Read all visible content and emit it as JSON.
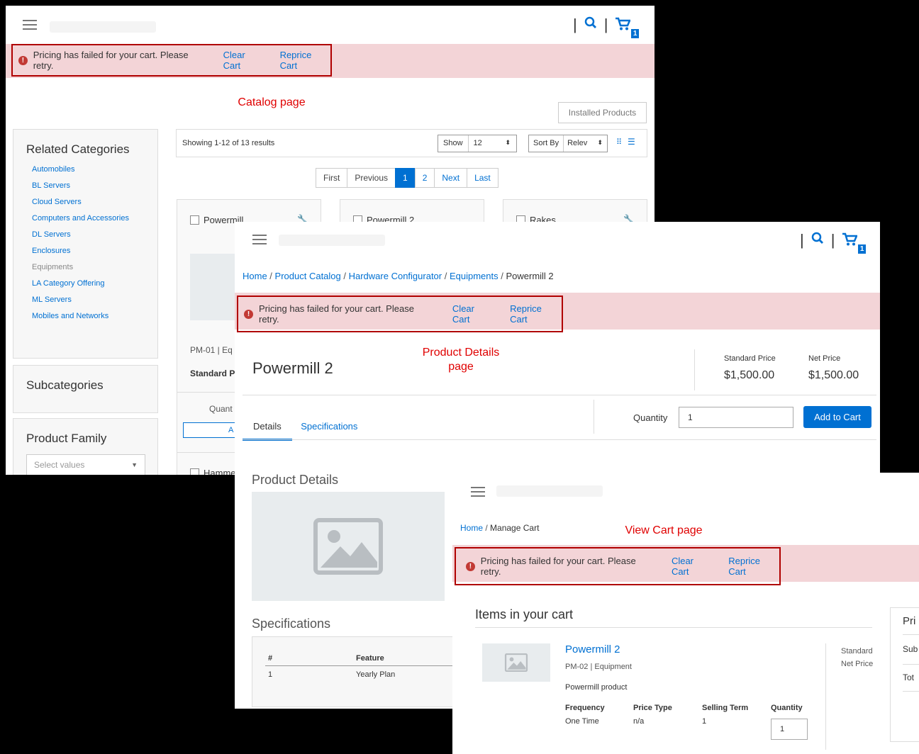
{
  "alert": {
    "message": "Pricing has failed for your cart. Please retry.",
    "clear_label": "Clear Cart",
    "reprice_label": "Reprice Cart",
    "icon": "alert-circle-icon"
  },
  "cart_count": "1",
  "notes": {
    "catalog": "Catalog page",
    "product_details": "Product Details page",
    "view_cart": "View Cart page"
  },
  "catalog": {
    "installed_products": "Installed Products",
    "related_categories_title": "Related Categories",
    "categories": [
      "Automobiles",
      "BL Servers",
      "Cloud Servers",
      "Computers and Accessories",
      "DL Servers",
      "Enclosures",
      "Equipments",
      "LA Category Offering",
      "ML Servers",
      "Mobiles and Networks"
    ],
    "subcategories_title": "Subcategories",
    "product_family_title": "Product Family",
    "product_family_placeholder": "Select values",
    "results_text": "Showing 1-12 of 13 results",
    "show_label": "Show",
    "show_value": "12",
    "sortby_label": "Sort By",
    "sortby_value": "Relev",
    "pager": [
      "First",
      "Previous",
      "1",
      "2",
      "Next",
      "Last"
    ],
    "products": [
      "Powermill",
      "Powermill 2",
      "Rakes",
      "Hamme"
    ],
    "product_code_partial": "PM-01 | Eq",
    "standard_price_partial": "Standard P",
    "quantity_partial": "Quant",
    "add_partial": "A"
  },
  "product_details": {
    "breadcrumb": [
      "Home",
      "Product Catalog",
      "Hardware Configurator",
      "Equipments",
      "Powermill 2"
    ],
    "title": "Powermill 2",
    "standard_price_label": "Standard Price",
    "standard_price": "$1,500.00",
    "net_price_label": "Net Price",
    "net_price": "$1,500.00",
    "quantity_label": "Quantity",
    "quantity_value": "1",
    "add_to_cart": "Add to Cart",
    "tabs": [
      "Details",
      "Specifications"
    ],
    "section_details": "Product Details",
    "section_specs": "Specifications",
    "spec_headers": [
      "#",
      "Feature"
    ],
    "spec_rows": [
      [
        "1",
        "Yearly Plan"
      ]
    ]
  },
  "view_cart": {
    "breadcrumb": [
      "Home",
      "Manage Cart"
    ],
    "items_title": "Items in your cart",
    "item_name": "Powermill 2",
    "item_code": "PM-02",
    "item_family": "Equipment",
    "item_desc": "Powermill product",
    "fields": [
      {
        "label": "Frequency",
        "value": "One Time"
      },
      {
        "label": "Price Type",
        "value": "n/a"
      },
      {
        "label": "Selling Term",
        "value": "1"
      },
      {
        "label": "Quantity",
        "value": "1"
      }
    ],
    "standard_label": "Standard",
    "net_price_label": "Net Price",
    "summary_partial": [
      "Pri",
      "Sub",
      "Tot"
    ]
  }
}
